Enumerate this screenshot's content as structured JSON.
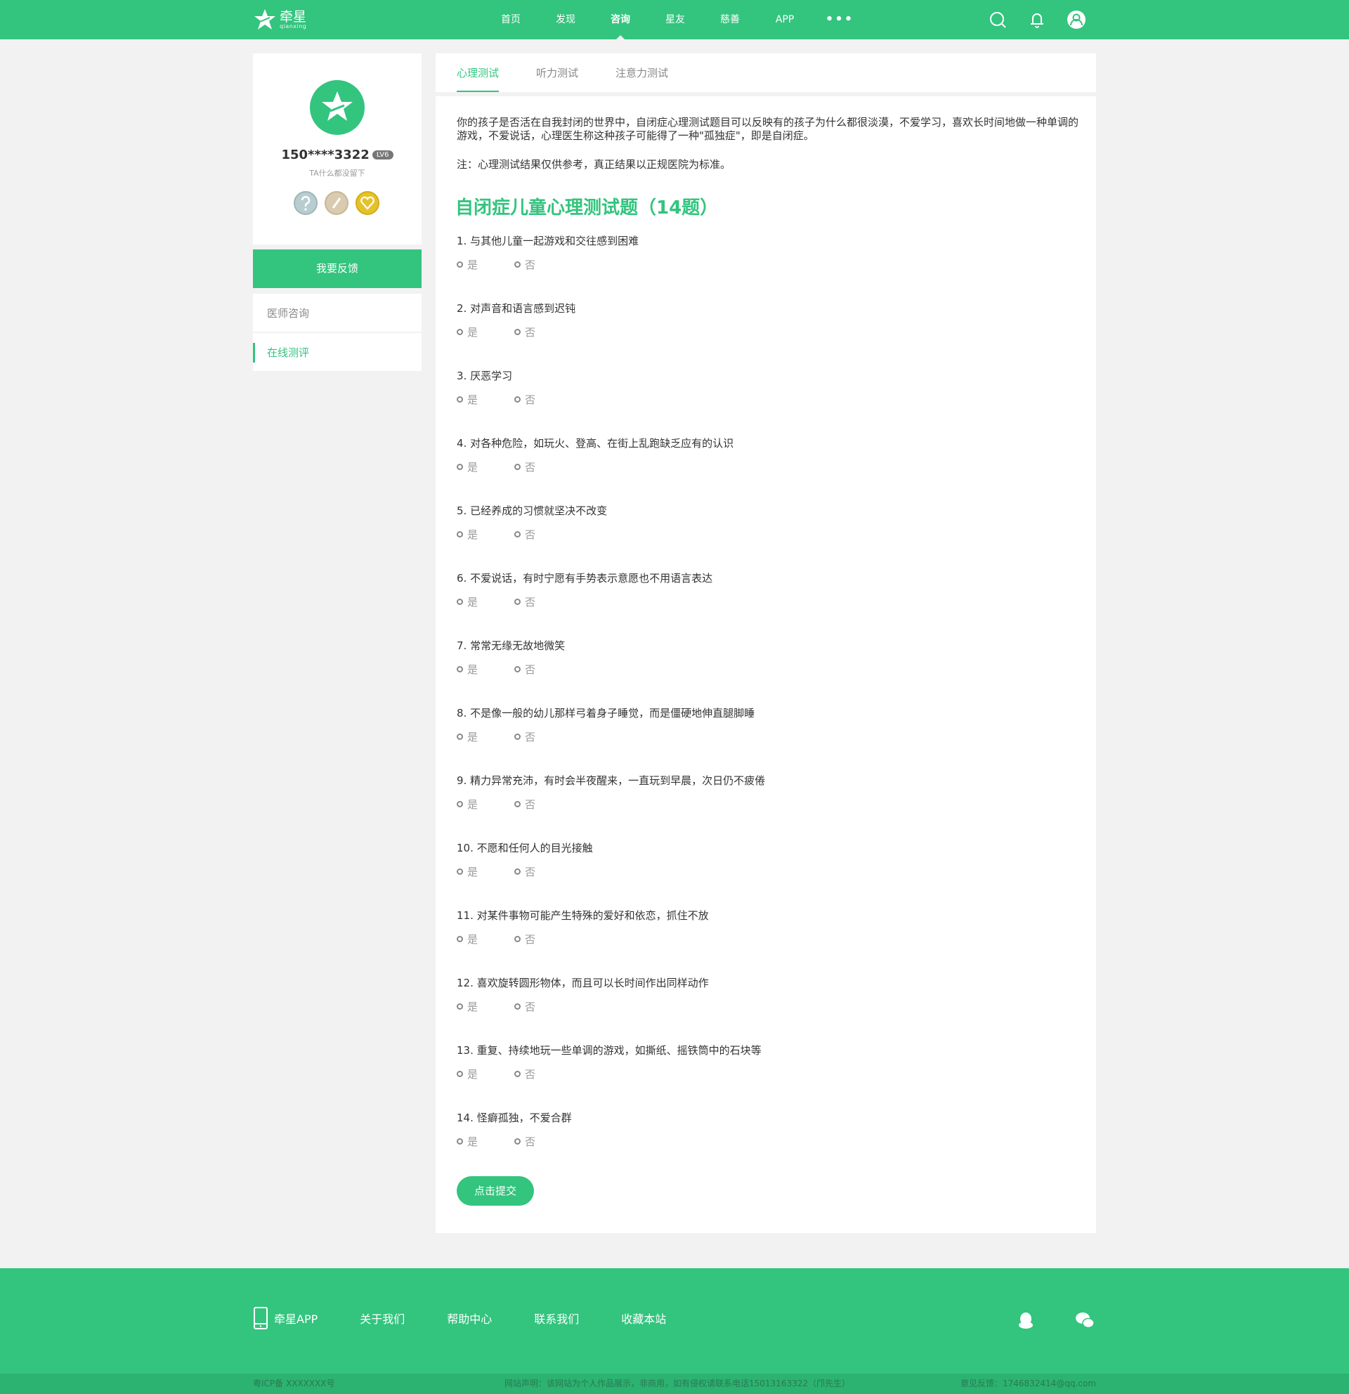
{
  "header": {
    "logo_name": "牵星",
    "logo_sub": "qianxing",
    "nav": [
      "首页",
      "发现",
      "咨询",
      "星友",
      "慈善",
      "APP",
      "•••"
    ],
    "active_nav": "咨询"
  },
  "sidebar": {
    "username": "150****3322",
    "level": "LV6",
    "bio": "TA什么都没留下",
    "badges": [
      "question-badge",
      "pencil-badge",
      "heart-badge"
    ],
    "feedback_button": "我要反馈",
    "menu": [
      {
        "label": "医师咨询",
        "active": false
      },
      {
        "label": "在线测评",
        "active": true
      }
    ]
  },
  "tabs": [
    "心理测试",
    "听力测试",
    "注意力测试"
  ],
  "main": {
    "intro": "你的孩子是否活在自我封闭的世界中，自闭症心理测试题目可以反映有的孩子为什么都很淡漠，不爱学习，喜欢长时间地做一种单调的游戏，不爱说话，心理医生称这种孩子可能得了一种\"孤独症\"，即是自闭症。",
    "note": "注：心理测试结果仅供参考，真正结果以正规医院为标准。",
    "title": "自闭症儿童心理测试题（14题）",
    "option_yes": "是",
    "option_no": "否",
    "questions": [
      "1. 与其他儿童一起游戏和交往感到困难",
      "2. 对声音和语言感到迟钝",
      "3. 厌恶学习",
      "4. 对各种危险，如玩火、登高、在街上乱跑缺乏应有的认识",
      "5. 已经养成的习惯就坚决不改变",
      "6. 不爱说话，有时宁愿有手势表示意愿也不用语言表达",
      "7. 常常无缘无故地微笑",
      "8. 不是像一般的幼儿那样弓着身子睡觉，而是僵硬地伸直腿脚睡",
      "9. 精力异常充沛，有时会半夜醒来，一直玩到早晨，次日仍不疲倦",
      "10. 不愿和任何人的目光接触",
      "11. 对某件事物可能产生特殊的爱好和依恋，抓住不放",
      "12. 喜欢旋转圆形物体，而且可以长时间作出同样动作",
      "13. 重复、持续地玩一些单调的游戏，如撕纸、摇铁筒中的石块等",
      "14. 怪癖孤独，不爱合群"
    ],
    "submit": "点击提交"
  },
  "footer": {
    "links": [
      "牵星APP",
      "关于我们",
      "帮助中心",
      "联系我们",
      "收藏本站"
    ],
    "icp": "粤ICP备 XXXXXXX号",
    "statement": "网站声明：该网站为个人作品展示，非商用，如有侵权请联系电话15013163322（邝先生）",
    "feedback": "意见反馈：1746832414@qq.com"
  },
  "colors": {
    "brand": "#33c47e",
    "background": "#f2f2f2"
  }
}
